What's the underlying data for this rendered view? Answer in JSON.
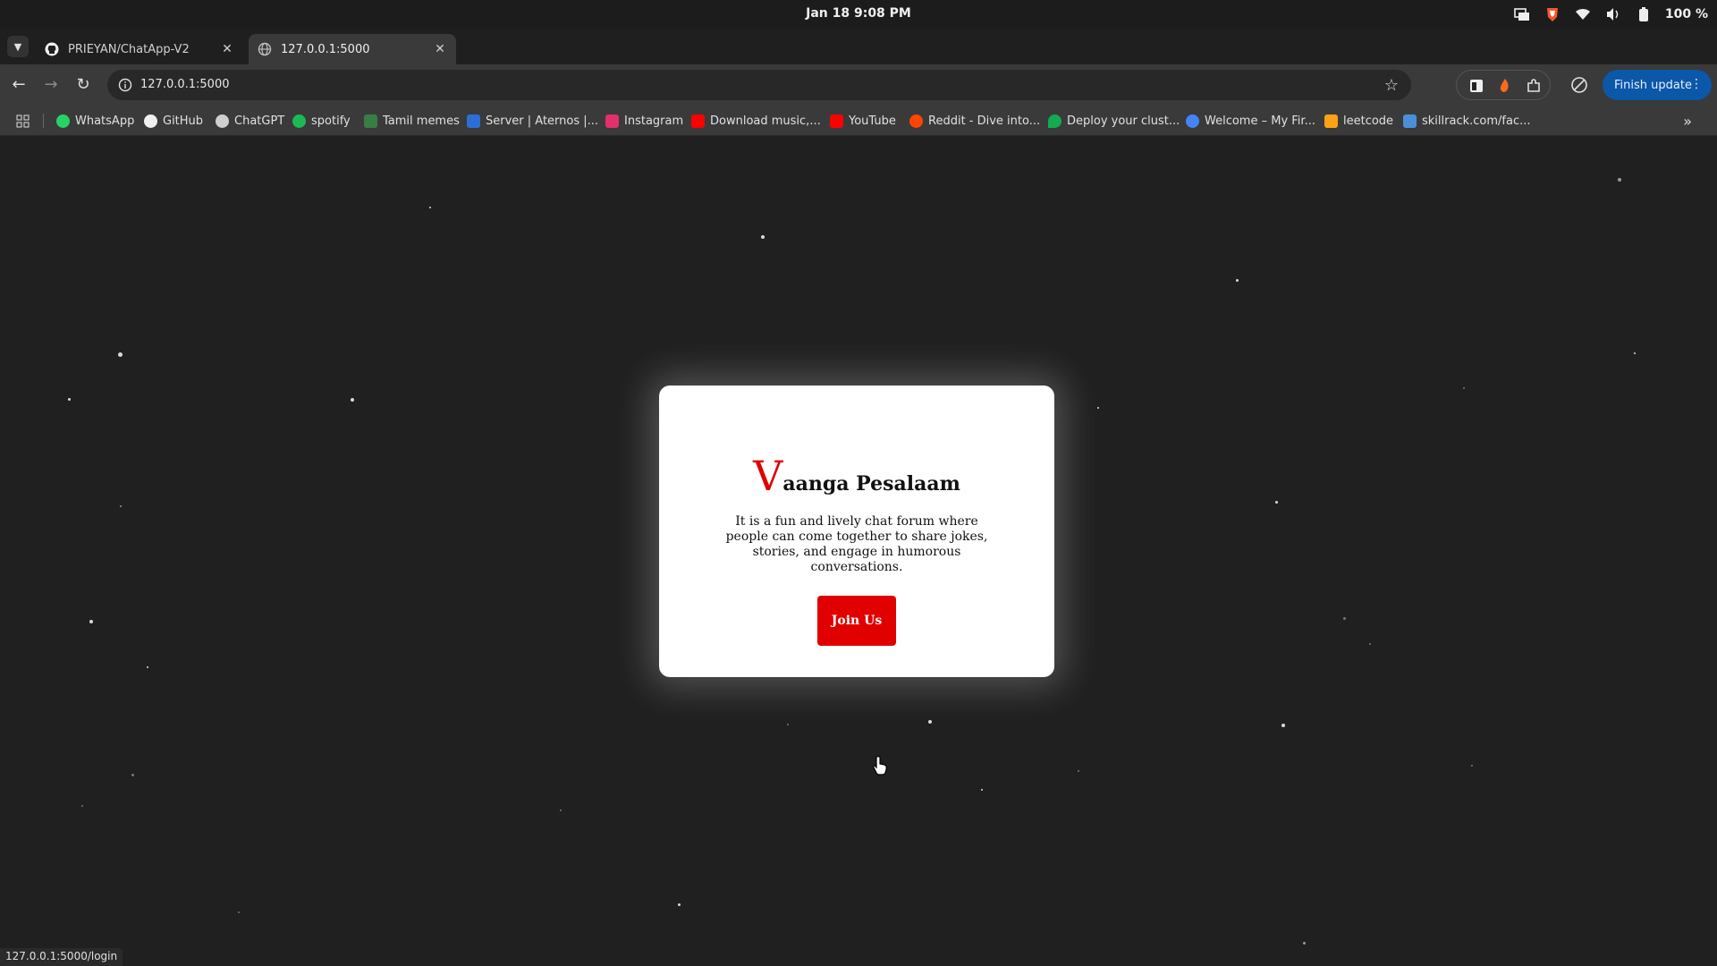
{
  "system": {
    "clock": "Jan 18  9:08 PM",
    "battery": "100 %"
  },
  "tabs": [
    {
      "title": "PRIEYAN/ChatApp-V2",
      "active": false,
      "icon": "github-icon"
    },
    {
      "title": "127.0.0.1:5000",
      "active": true,
      "icon": "globe-icon"
    }
  ],
  "toolbar": {
    "url": "127.0.0.1:5000",
    "finish_update": "Finish update"
  },
  "bookmarks": [
    {
      "label": "WhatsApp",
      "color": "#25d366"
    },
    {
      "label": "GitHub",
      "color": "#f0f0f0"
    },
    {
      "label": "ChatGPT",
      "color": "#cfcfcf"
    },
    {
      "label": "spotify",
      "color": "#1db954"
    },
    {
      "label": "Tamil memes",
      "color": "#3a7d44"
    },
    {
      "label": "Server | Aternos |...",
      "color": "#2b6fd6"
    },
    {
      "label": "Instagram",
      "color": "#e1306c"
    },
    {
      "label": "Download music,...",
      "color": "#ff0000"
    },
    {
      "label": "YouTube",
      "color": "#ff0000"
    },
    {
      "label": "Reddit - Dive into...",
      "color": "#ff4500"
    },
    {
      "label": "Deploy your clust...",
      "color": "#13aa52"
    },
    {
      "label": "Welcome – My Fir...",
      "color": "#4285f4"
    },
    {
      "label": "leetcode",
      "color": "#ffa116"
    },
    {
      "label": "skillrack.com/fac...",
      "color": "#4a90d9"
    }
  ],
  "card": {
    "title_initial": "V",
    "title_rest": "aanga Pesalaam",
    "description": "It is a fun and lively chat forum where people can come together to share jokes, stories, and engage in humorous conversations.",
    "button": "Join Us"
  },
  "status_url": "127.0.0.1:5000/login",
  "colors": {
    "accent_red": "#e00000",
    "update_blue": "#0b57a8"
  }
}
